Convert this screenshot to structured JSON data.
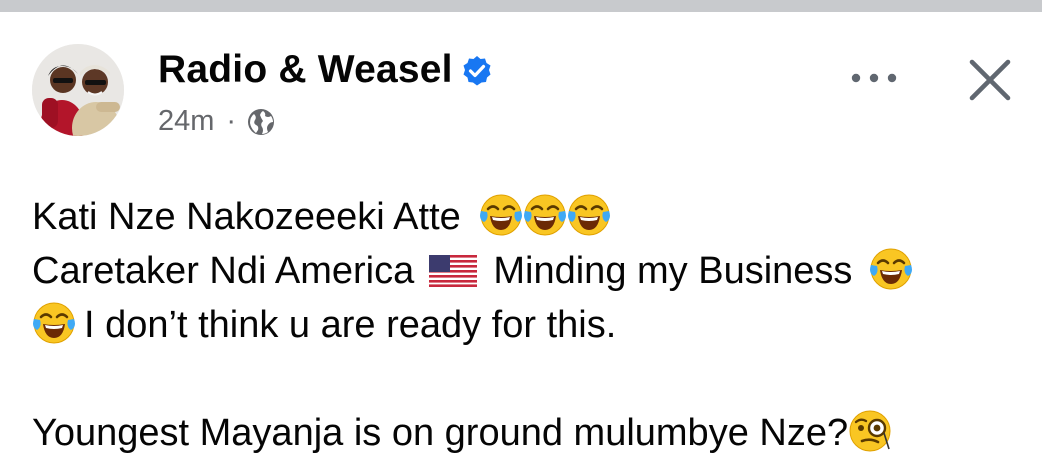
{
  "post": {
    "author": "Radio & Weasel",
    "verified": true,
    "timestamp": "24m",
    "separator": "·",
    "privacy_icon": "globe-icon",
    "more_icon": "more-horizontal-icon",
    "close_icon": "close-icon",
    "body": {
      "line1_text": "Kati Nze Nakozeeeki Atte",
      "line1_emojis": [
        "face-with-tears-of-joy",
        "face-with-tears-of-joy",
        "face-with-tears-of-joy"
      ],
      "line2_text_a": "Caretaker Ndi America",
      "line2_flag": "us-flag",
      "line2_text_b": "Minding my Business",
      "line2_emoji": "face-with-tears-of-joy",
      "line3_emoji": "face-with-tears-of-joy",
      "line3_text": "I don’t think u are ready for this.",
      "line5_text": "Youngest Mayanja is on ground mulumbye Nze?",
      "line5_emoji": "face-with-monocle"
    }
  },
  "colors": {
    "verified_blue": "#1877f2",
    "meta_gray": "#65676b",
    "text": "#050505",
    "top_strip": "#c8cacd"
  }
}
